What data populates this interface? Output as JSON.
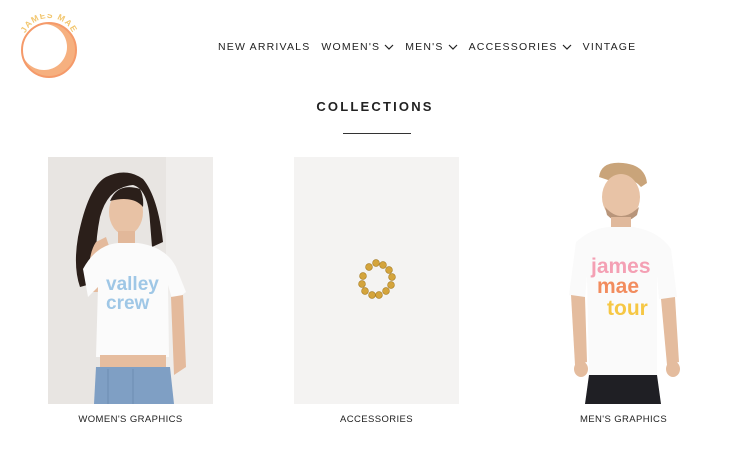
{
  "brand": {
    "logo_text": "JAMES MAE"
  },
  "nav": {
    "items": [
      {
        "label": "NEW ARRIVALS",
        "has_dropdown": false
      },
      {
        "label": "WOMEN'S",
        "has_dropdown": true
      },
      {
        "label": "MEN'S",
        "has_dropdown": true
      },
      {
        "label": "ACCESSORIES",
        "has_dropdown": true
      },
      {
        "label": "VINTAGE",
        "has_dropdown": false
      }
    ]
  },
  "collections": {
    "title": "COLLECTIONS",
    "cards": [
      {
        "label": "WOMEN'S GRAPHICS",
        "shirt_text": [
          "valley",
          "crew"
        ]
      },
      {
        "label": "ACCESSORIES"
      },
      {
        "label": "MEN'S GRAPHICS",
        "shirt_text": [
          "james",
          "mae",
          "tour"
        ]
      }
    ]
  },
  "colors": {
    "logo_orange": "#f28c5e",
    "logo_gold": "#f2c66e",
    "shirt_blue": "#9fc7e6",
    "gold_jewelry": "#d4a43c"
  }
}
